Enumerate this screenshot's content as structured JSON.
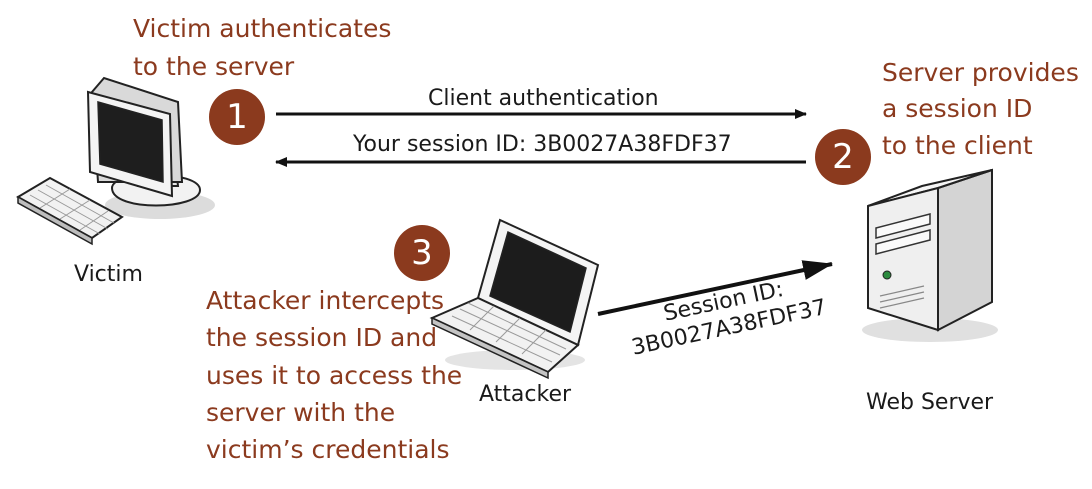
{
  "colors": {
    "accent_text": "#8b3a1e",
    "step_circle": "#8b3a1e",
    "arrow": "#111111"
  },
  "steps": [
    {
      "number": "1",
      "text": [
        "Victim authenticates",
        "to the server"
      ]
    },
    {
      "number": "2",
      "text": [
        "Server provides",
        "a session ID",
        "to the client"
      ]
    },
    {
      "number": "3",
      "text": [
        "Attacker intercepts",
        "the session ID and",
        "uses it to access the",
        "server with the",
        "victim’s credentials"
      ]
    }
  ],
  "arrows": {
    "client_auth_label": "Client authentication",
    "session_response_label": "Your session ID: 3B0027A38FDF37",
    "intercepted_label_line1": "Session ID:",
    "intercepted_label_line2": "3B0027A38FDF37"
  },
  "nodes": {
    "victim": {
      "label": "Victim",
      "icon": "desktop-computer-icon"
    },
    "attacker": {
      "label": "Attacker",
      "icon": "laptop-icon"
    },
    "server": {
      "label": "Web Server",
      "icon": "tower-server-icon"
    }
  }
}
